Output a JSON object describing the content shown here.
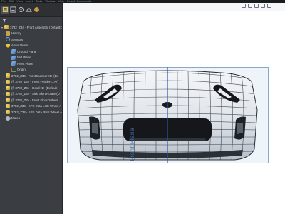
{
  "topbar": {
    "items": [
      "File",
      "Edit",
      "View",
      "Insert",
      "Tools",
      "Window",
      "Help",
      "Search Commands"
    ]
  },
  "panel": {
    "tabs": [
      "feature-manager-icon",
      "property-manager-icon",
      "configuration-manager-icon",
      "dimxpert-icon",
      "display-manager-icon"
    ],
    "tree": [
      {
        "label": "3782_Z34 - Front Assembly (Default<",
        "icon": "assembly",
        "level": 0,
        "expander": "▾"
      },
      {
        "label": "History",
        "icon": "folder",
        "level": 1,
        "expander": "›"
      },
      {
        "label": "Sensors",
        "icon": "sensor",
        "level": 1,
        "expander": ""
      },
      {
        "label": "Annotations",
        "icon": "annot",
        "level": 1,
        "expander": "›"
      },
      {
        "label": "Ground Plane",
        "icon": "plane",
        "level": 2,
        "expander": ""
      },
      {
        "label": "Mid Plane",
        "icon": "plane",
        "level": 2,
        "expander": ""
      },
      {
        "label": "Front Plane",
        "icon": "plane",
        "level": 2,
        "expander": ""
      },
      {
        "label": "Origin",
        "icon": "origin",
        "level": 2,
        "expander": ""
      },
      {
        "label": "3782_Z34 - Front Bumper<1> (De",
        "icon": "part",
        "level": 1,
        "expander": "›"
      },
      {
        "label": "(f) 3782_Z34 - Front Fender<1> (",
        "icon": "part",
        "level": 1,
        "expander": "›"
      },
      {
        "label": "(f) 3782_Z34 - Hood<1> (Default<",
        "icon": "part",
        "level": 1,
        "expander": "›"
      },
      {
        "label": "(f) 3782_Z34 - Side Skirt Rotate (D",
        "icon": "part",
        "level": 1,
        "expander": "›"
      },
      {
        "label": "(f) 3782_Z34 - Front Floor<Wheel",
        "icon": "part",
        "level": 1,
        "expander": "›"
      },
      {
        "label": "3782_Z34 - SPS Data LHS Wheel A",
        "icon": "part",
        "level": 1,
        "expander": "›"
      },
      {
        "label": "3782_Z34 - SPS Data RHS Wheel A",
        "icon": "part",
        "level": 1,
        "expander": "›"
      },
      {
        "label": "Mates",
        "icon": "mates",
        "level": 1,
        "expander": "›"
      }
    ]
  },
  "viewport": {
    "plane_label": "Front Plane",
    "heads_up_icons": [
      "zoom-fit-icon",
      "zoom-area-icon",
      "previous-view-icon",
      "section-view-icon",
      "view-orientation-icon"
    ],
    "colors": {
      "plane_fill": "#e1e9f6",
      "plane_border": "#8aa6cf",
      "plane_label": "#3f6da6",
      "centerline": "#2a56a8"
    }
  }
}
